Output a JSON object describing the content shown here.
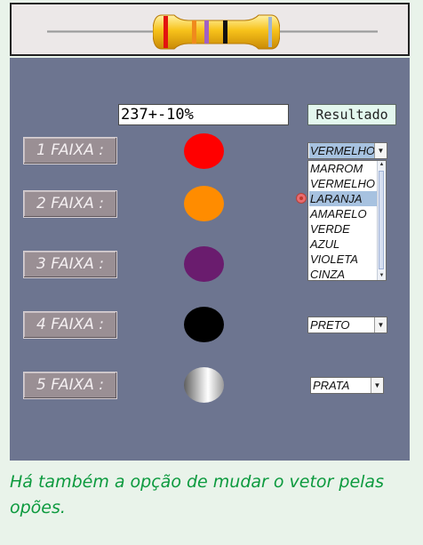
{
  "colors": {
    "band1": "#ff0000",
    "band2": "#ff8c00",
    "band3": "#6a1c6e",
    "band4": "#000000",
    "band5": "silver-gradient",
    "caption": "#0c9a3e",
    "panel": "#6d7590"
  },
  "banner": {
    "image": "resistor-with-color-bands"
  },
  "readout": {
    "value": "237+-10%"
  },
  "result_button": {
    "label": "Resultado"
  },
  "bands": [
    {
      "label": "1 FAIXA :"
    },
    {
      "label": "2 FAIXA :"
    },
    {
      "label": "3 FAIXA :"
    },
    {
      "label": "4 FAIXA :"
    },
    {
      "label": "5 FAIXA :"
    }
  ],
  "band1_select": {
    "value": "VERMELHO"
  },
  "band2_list": {
    "options": [
      "MARROM",
      "VERMELHO",
      "LARANJA",
      "AMARELO",
      "VERDE",
      "AZUL",
      "VIOLETA",
      "CINZA"
    ],
    "selected": "LARANJA"
  },
  "band4_select": {
    "value": "PRETO"
  },
  "band5_select": {
    "value": "PRATA"
  },
  "caption": "Há também a opção de mudar o vetor pelas opões."
}
